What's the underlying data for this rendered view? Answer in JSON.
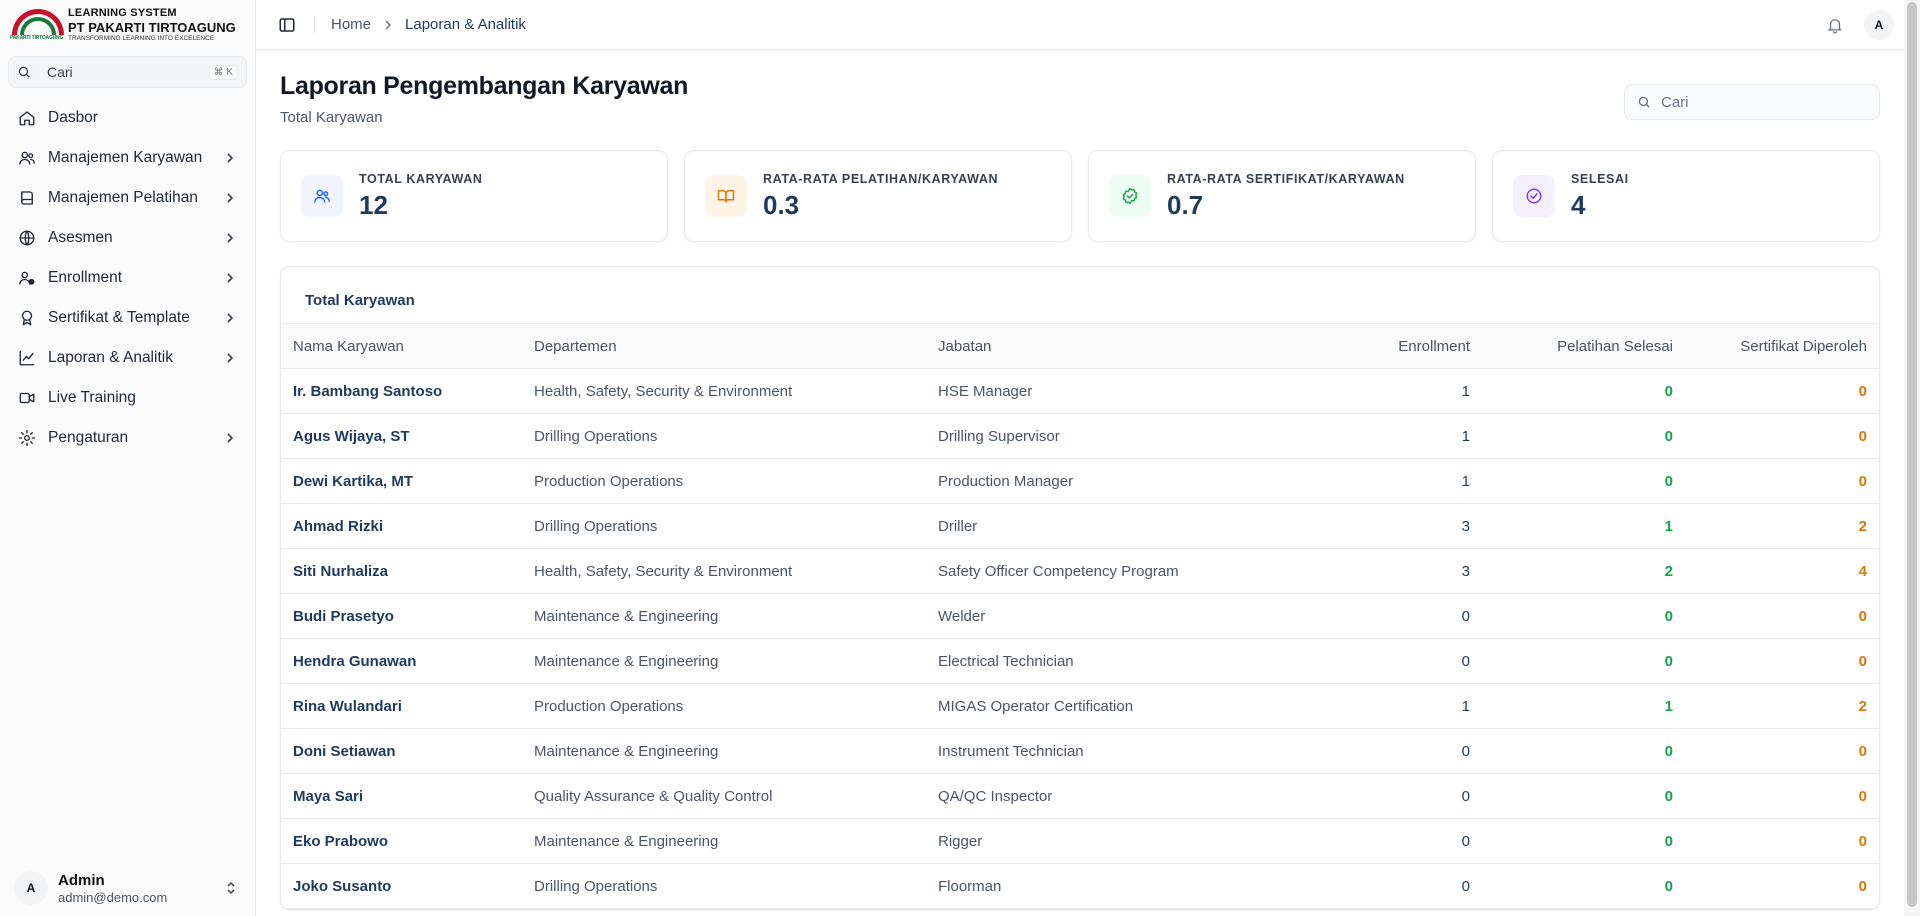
{
  "brand": {
    "logo_text": "PAKARTI TIRTOAGUNG",
    "line1": "LEARNING SYSTEM",
    "line2": "PT PAKARTI TIRTOAGUNG",
    "line3": "TRANSFORMING LEARNING INTO EXCELENCE"
  },
  "sidebar": {
    "search": {
      "label": "Cari",
      "shortcut": "⌘ K"
    },
    "items": [
      {
        "label": "Dasbor",
        "icon": "home-icon",
        "has_children": false
      },
      {
        "label": "Manajemen Karyawan",
        "icon": "users-icon",
        "has_children": true
      },
      {
        "label": "Manajemen Pelatihan",
        "icon": "book-icon",
        "has_children": true
      },
      {
        "label": "Asesmen",
        "icon": "globe-icon",
        "has_children": true
      },
      {
        "label": "Enrollment",
        "icon": "user-check-icon",
        "has_children": true
      },
      {
        "label": "Sertifikat & Template",
        "icon": "award-icon",
        "has_children": true
      },
      {
        "label": "Laporan & Analitik",
        "icon": "chart-icon",
        "has_children": true
      },
      {
        "label": "Live Training",
        "icon": "video-icon",
        "has_children": false
      },
      {
        "label": "Pengaturan",
        "icon": "gear-icon",
        "has_children": true
      }
    ],
    "user": {
      "initial": "A",
      "name": "Admin",
      "email": "admin@demo.com"
    }
  },
  "topbar": {
    "breadcrumb": [
      "Home",
      "Laporan & Analitik"
    ],
    "avatar_initial": "A"
  },
  "page": {
    "title": "Laporan Pengembangan Karyawan",
    "subtitle": "Total Karyawan",
    "search_placeholder": "Cari"
  },
  "stats": [
    {
      "label": "TOTAL KARYAWAN",
      "value": "12",
      "icon": "users-icon",
      "color": "#2563eb",
      "bg": "#eff4ff"
    },
    {
      "label": "RATA-RATA PELATIHAN/KARYAWAN",
      "value": "0.3",
      "icon": "book-open-icon",
      "color": "#d97706",
      "bg": "#fff4e6"
    },
    {
      "label": "RATA-RATA SERTIFIKAT/KARYAWAN",
      "value": "0.7",
      "icon": "badge-check-icon",
      "color": "#16a34a",
      "bg": "#ecfdf3"
    },
    {
      "label": "SELESAI",
      "value": "4",
      "icon": "circle-check-icon",
      "color": "#7c3aed",
      "bg": "#f5f0ff"
    }
  ],
  "table": {
    "title": "Total Karyawan",
    "columns": [
      "Nama Karyawan",
      "Departemen",
      "Jabatan",
      "Enrollment",
      "Pelatihan Selesai",
      "Sertifikat Diperoleh"
    ],
    "rows": [
      [
        "Ir. Bambang Santoso",
        "Health, Safety, Security & Environment",
        "HSE Manager",
        "1",
        "0",
        "0"
      ],
      [
        "Agus Wijaya, ST",
        "Drilling Operations",
        "Drilling Supervisor",
        "1",
        "0",
        "0"
      ],
      [
        "Dewi Kartika, MT",
        "Production Operations",
        "Production Manager",
        "1",
        "0",
        "0"
      ],
      [
        "Ahmad Rizki",
        "Drilling Operations",
        "Driller",
        "3",
        "1",
        "2"
      ],
      [
        "Siti Nurhaliza",
        "Health, Safety, Security & Environment",
        "Safety Officer Competency Program",
        "3",
        "2",
        "4"
      ],
      [
        "Budi Prasetyo",
        "Maintenance & Engineering",
        "Welder",
        "0",
        "0",
        "0"
      ],
      [
        "Hendra Gunawan",
        "Maintenance & Engineering",
        "Electrical Technician",
        "0",
        "0",
        "0"
      ],
      [
        "Rina Wulandari",
        "Production Operations",
        "MIGAS Operator Certification",
        "1",
        "1",
        "2"
      ],
      [
        "Doni Setiawan",
        "Maintenance & Engineering",
        "Instrument Technician",
        "0",
        "0",
        "0"
      ],
      [
        "Maya Sari",
        "Quality Assurance & Quality Control",
        "QA/QC Inspector",
        "0",
        "0",
        "0"
      ],
      [
        "Eko Prabowo",
        "Maintenance & Engineering",
        "Rigger",
        "0",
        "0",
        "0"
      ],
      [
        "Joko Susanto",
        "Drilling Operations",
        "Floorman",
        "0",
        "0",
        "0"
      ]
    ]
  }
}
